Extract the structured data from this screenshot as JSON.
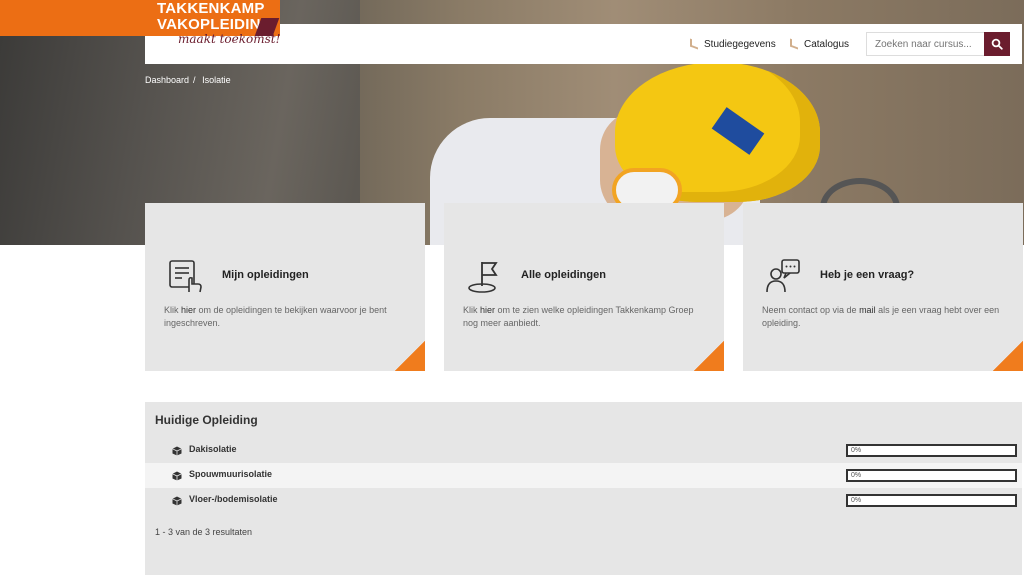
{
  "brand": {
    "line1": "TAKKENKAMP",
    "line2": "VAKOPLEIDING",
    "slogan": "maakt toekomst!",
    "primary_color": "#ec6e14",
    "accent_color": "#6b1d2e"
  },
  "nav": {
    "items": [
      {
        "label": "Studiegegevens"
      },
      {
        "label": "Catalogus"
      }
    ]
  },
  "search": {
    "placeholder": "Zoeken naar cursus...",
    "icon": "search-icon"
  },
  "breadcrumb": {
    "items": [
      "Dashboard",
      "Isolatie"
    ],
    "separator": "/"
  },
  "cards": [
    {
      "icon": "document-hand-icon",
      "title": "Mijn opleidingen",
      "desc_pre": "Klik ",
      "desc_link": "hier",
      "desc_post": " om de opleidingen te bekijken waarvoor je bent ingeschreven."
    },
    {
      "icon": "flag-icon",
      "title": "Alle opleidingen",
      "desc_pre": "Klik ",
      "desc_link": "hier",
      "desc_post": " om te zien welke opleidingen Takkenkamp Groep nog meer aanbiedt."
    },
    {
      "icon": "person-chat-icon",
      "title": "Heb je een vraag?",
      "desc_pre": "Neem contact op via de ",
      "desc_link": "mail",
      "desc_post": " als je een vraag hebt over een opleiding."
    }
  ],
  "current": {
    "title": "Huidige Opleiding",
    "courses": [
      {
        "name": "Dakisolatie",
        "progress_label": "0%",
        "progress": 0
      },
      {
        "name": "Spouwmuurisolatie",
        "progress_label": "0%",
        "progress": 0
      },
      {
        "name": "Vloer-/bodemisolatie",
        "progress_label": "0%",
        "progress": 0
      }
    ],
    "results_text": "1 - 3 van de 3 resultaten"
  }
}
